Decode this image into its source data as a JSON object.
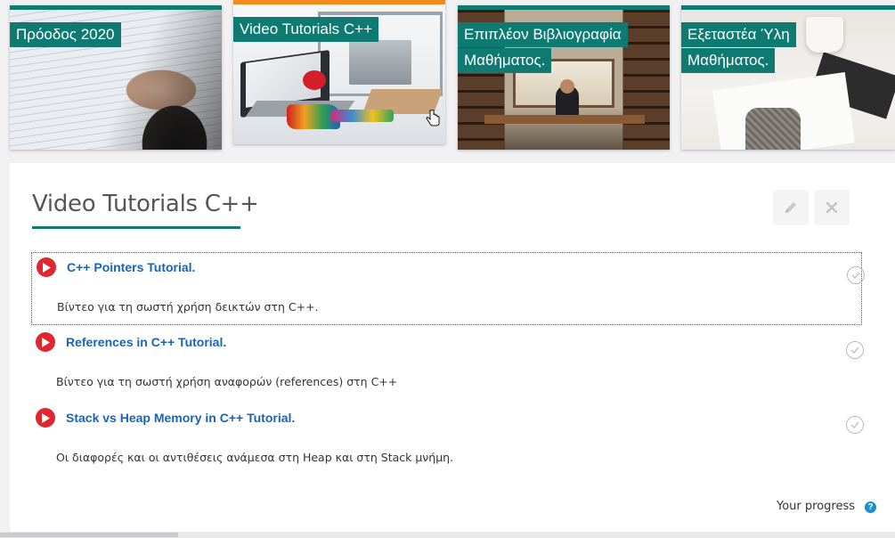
{
  "tiles": [
    {
      "title_lines": [
        "Πρόοδος 2020"
      ],
      "active": false
    },
    {
      "title_lines": [
        "Video Tutorials C++"
      ],
      "active": true
    },
    {
      "title_lines": [
        "Επιπλέον Βιβλιογραφία",
        "Μαθήματος."
      ],
      "active": false
    },
    {
      "title_lines": [
        "Εξεταστέα Ύλη",
        "Μαθήματος."
      ],
      "active": false
    }
  ],
  "section": {
    "title": "Video Tutorials C++",
    "edit_icon": "pencil-icon",
    "close_icon": "close-icon"
  },
  "activities": [
    {
      "title": "C++ Pointers Tutorial.",
      "description": "Βίντεο για τη σωστή χρήση δεικτών στη C++.",
      "completed": false
    },
    {
      "title": "References in C++ Tutorial.",
      "description": "Βίντεο για τη σωστή χρήση αναφορών (references) στη C++",
      "completed": false
    },
    {
      "title": "Stack vs Heap Memory in C++ Tutorial.",
      "description": "Οι διαφορές και οι αντιθέσεις ανάμεσα στη Heap και στη Stack μνήμη.",
      "completed": false
    }
  ],
  "progress": {
    "label": "Your progress",
    "help": "?"
  },
  "colors": {
    "accent": "#0f7a72",
    "active_tab": "#f28a1e",
    "link": "#1a64b4",
    "play": "#e0262f"
  }
}
